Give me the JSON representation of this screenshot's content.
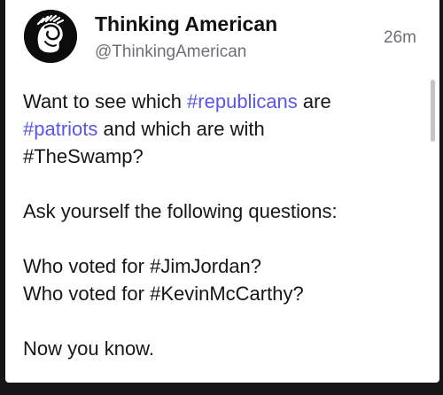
{
  "post": {
    "author": {
      "display_name": "Thinking American",
      "handle": "@ThinkingAmerican",
      "avatar_icon": "thinking-american-logo-avatar"
    },
    "timestamp": "26m",
    "body": {
      "line1_prefix": "Want to see which ",
      "hashtag_republicans": "#republicans",
      "line1_suffix": " are",
      "hashtag_patriots": "#patriots",
      "line2_suffix": " and which are with",
      "hashtag_theswamp": "#TheSwamp",
      "line3_suffix": "?",
      "question_prompt": "Ask yourself the following questions:",
      "q1_prefix": "Who voted for ",
      "hashtag_jimjordan": "#JimJordan",
      "q1_suffix": "?",
      "q2_prefix": "Who voted for ",
      "hashtag_kevinmccarthy": "#KevinMcCarthy",
      "q2_suffix": "?",
      "closing": "Now you know."
    }
  },
  "colors": {
    "hashtag_link": "#5a55e8",
    "text": "#161616",
    "muted": "#6f6f76",
    "background": "#ffffff"
  }
}
